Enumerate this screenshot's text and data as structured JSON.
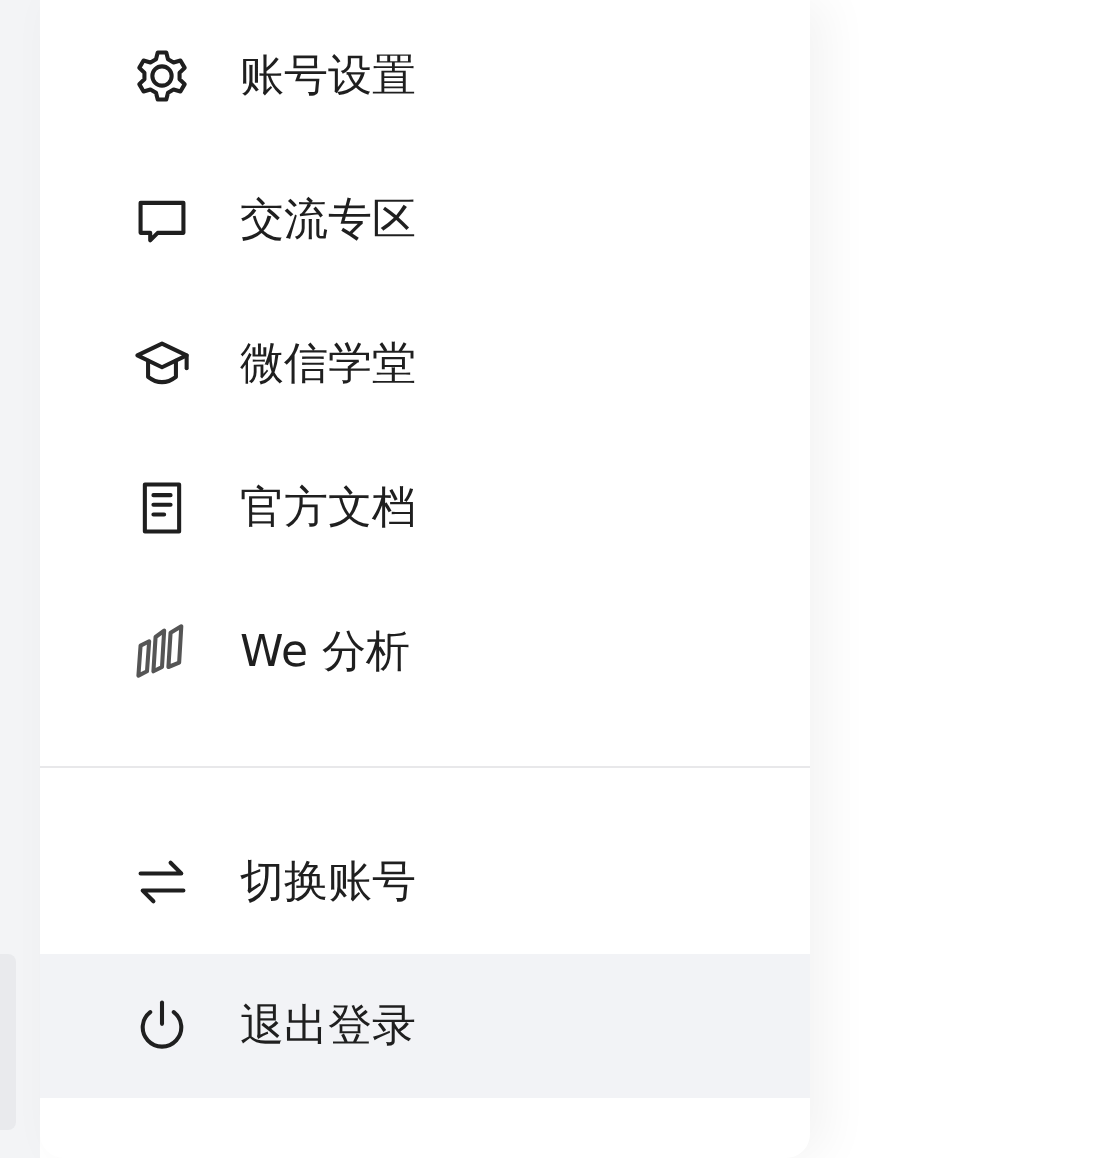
{
  "menu": {
    "groups": [
      {
        "items": [
          {
            "kind": "settings",
            "label": "账号设置",
            "highlighted": false
          },
          {
            "kind": "chat",
            "label": "交流专区",
            "highlighted": false
          },
          {
            "kind": "academy",
            "label": "微信学堂",
            "highlighted": false
          },
          {
            "kind": "document",
            "label": "官方文档",
            "highlighted": false
          },
          {
            "kind": "analytics",
            "label": "We 分析",
            "highlighted": false
          }
        ]
      },
      {
        "items": [
          {
            "kind": "switch",
            "label": "切换账号",
            "highlighted": false
          },
          {
            "kind": "logout",
            "label": "退出登录",
            "highlighted": true
          }
        ]
      }
    ]
  }
}
